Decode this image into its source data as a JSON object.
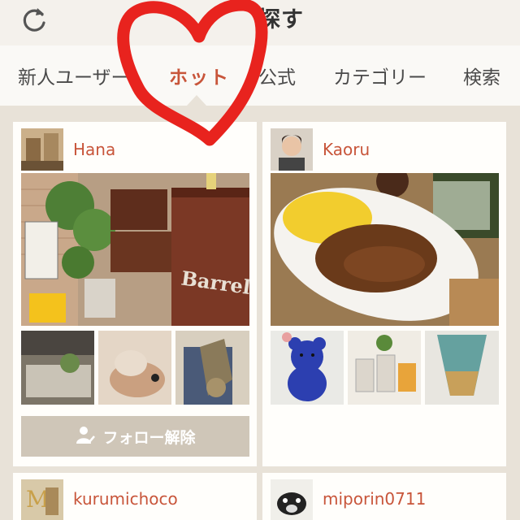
{
  "header": {
    "title": "探す"
  },
  "tabs": [
    {
      "label": "新人ユーザー"
    },
    {
      "label": "ホット"
    },
    {
      "label": "公式"
    },
    {
      "label": "カテゴリー"
    },
    {
      "label": "検索"
    }
  ],
  "active_tab": "ホット",
  "cards": [
    {
      "username": "Hana",
      "follow_label": "フォロー解除",
      "main_photo_text": "Barrel"
    },
    {
      "username": "Kaoru"
    },
    {
      "username": "kurumichoco"
    },
    {
      "username": "miporin0711"
    }
  ],
  "colors": {
    "accent": "#c8553a",
    "background": "#e8e2d8",
    "scribble": "#e8231e",
    "button": "#cfc6b8"
  },
  "icons": {
    "refresh": "refresh-icon",
    "follow": "person-check-icon"
  }
}
